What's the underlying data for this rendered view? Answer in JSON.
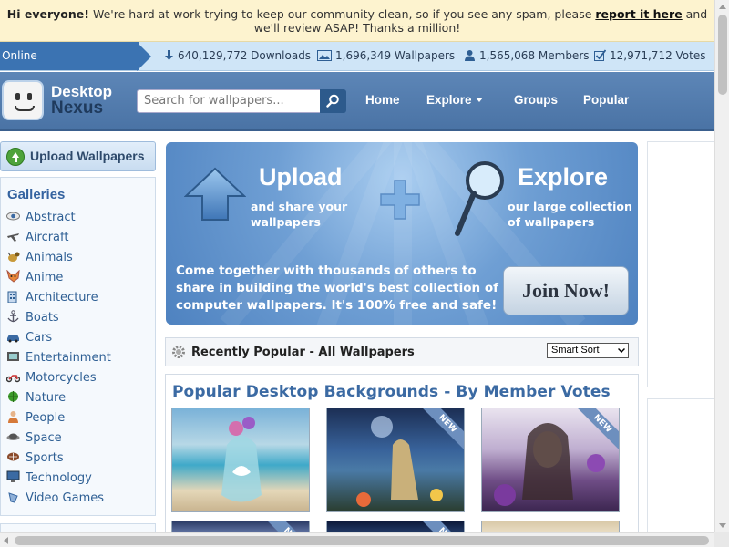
{
  "announcement": {
    "greeting": "Hi everyone!",
    "text_before": " We're hard at work trying to keep our community clean, so if you see any spam, please ",
    "link": "report it here",
    "text_after": " and we'll review ASAP!  Thanks a million!"
  },
  "stats": {
    "online": "s Online",
    "downloads": "640,129,772 Downloads",
    "wallpapers": "1,696,349 Wallpapers",
    "members": "1,565,068 Members",
    "votes": "12,971,712 Votes"
  },
  "header": {
    "logo_line1": "Desktop",
    "logo_line2": "Nexus",
    "search_placeholder": "Search for wallpapers...",
    "nav": [
      "Home",
      "Explore",
      "Groups",
      "Popular"
    ]
  },
  "sidebar": {
    "upload_label": "Upload Wallpapers",
    "galleries_title": "Galleries",
    "items": [
      {
        "label": "Abstract",
        "icon": "eye-icon"
      },
      {
        "label": "Aircraft",
        "icon": "airplane-icon"
      },
      {
        "label": "Animals",
        "icon": "animal-icon"
      },
      {
        "label": "Anime",
        "icon": "fox-icon"
      },
      {
        "label": "Architecture",
        "icon": "building-icon"
      },
      {
        "label": "Boats",
        "icon": "anchor-icon"
      },
      {
        "label": "Cars",
        "icon": "car-icon"
      },
      {
        "label": "Entertainment",
        "icon": "film-icon"
      },
      {
        "label": "Motorcycles",
        "icon": "motorcycle-icon"
      },
      {
        "label": "Nature",
        "icon": "leaf-icon"
      },
      {
        "label": "People",
        "icon": "person-icon"
      },
      {
        "label": "Space",
        "icon": "planet-icon"
      },
      {
        "label": "Sports",
        "icon": "ball-icon"
      },
      {
        "label": "Technology",
        "icon": "computer-icon"
      },
      {
        "label": "Video Games",
        "icon": "gamepad-icon"
      }
    ]
  },
  "banner": {
    "upload_title": "Upload",
    "upload_sub": "and share your wallpapers",
    "explore_title": "Explore",
    "explore_sub": "our large collection of wallpapers",
    "body": "Come together with thousands of others to share in building the world's best collection of computer wallpapers. It's 100% free and safe!",
    "join_label": "Join Now!"
  },
  "recent": {
    "title": "Recently Popular - All Wallpapers",
    "sort_value": "Smart Sort"
  },
  "gallery": {
    "title": "Popular Desktop Backgrounds - By Member Votes",
    "new_badge": "NEW"
  },
  "colors": {
    "accent": "#3b6aa3",
    "header_bg": "#5380b3",
    "announce_bg": "#fdf3cf"
  }
}
